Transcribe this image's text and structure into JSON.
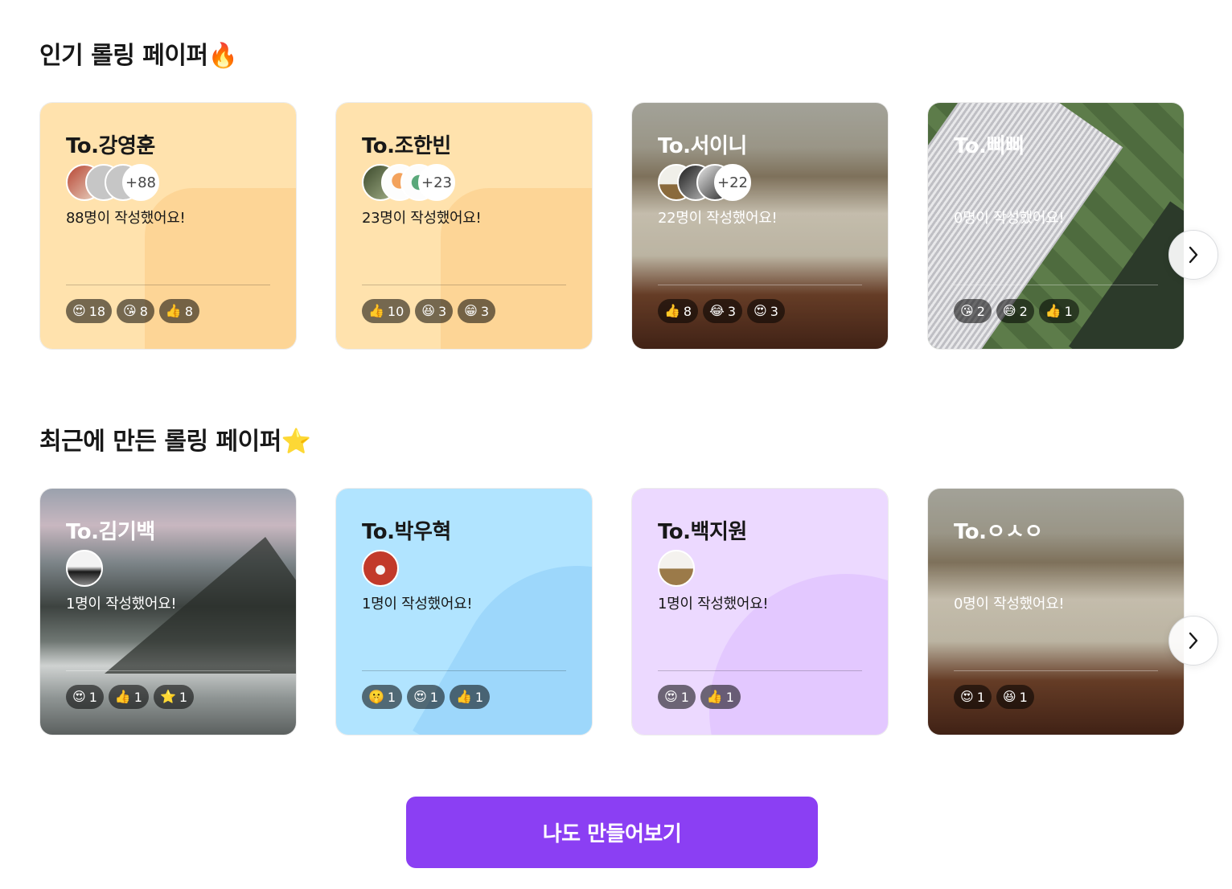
{
  "popular": {
    "title": "인기 롤링 페이퍼",
    "title_icon": "fire-icon",
    "cards": [
      {
        "to": "To.강영훈",
        "more": "+88",
        "count_text": "88명이 작성했어요!",
        "bg": "orange",
        "reactions": [
          {
            "emoji": "😍",
            "count": "18"
          },
          {
            "emoji": "😘",
            "count": "8"
          },
          {
            "emoji": "👍",
            "count": "8"
          }
        ]
      },
      {
        "to": "To.조한빈",
        "more": "+23",
        "count_text": "23명이 작성했어요!",
        "bg": "orange",
        "reactions": [
          {
            "emoji": "👍",
            "count": "10"
          },
          {
            "emoji": "😆",
            "count": "3"
          },
          {
            "emoji": "😁",
            "count": "3"
          }
        ]
      },
      {
        "to": "To.서이니",
        "more": "+22",
        "count_text": "22명이 작성했어요!",
        "bg": "book-image",
        "reactions": [
          {
            "emoji": "👍",
            "count": "8"
          },
          {
            "emoji": "😂",
            "count": "3"
          },
          {
            "emoji": "😍",
            "count": "3"
          }
        ]
      },
      {
        "to": "To.삐삐",
        "count_text": "0명이 작성했어요!",
        "bg": "stadium-image",
        "reactions": [
          {
            "emoji": "😘",
            "count": "2"
          },
          {
            "emoji": "😅",
            "count": "2"
          },
          {
            "emoji": "👍",
            "count": "1"
          }
        ]
      }
    ]
  },
  "recent": {
    "title": "최근에 만든 롤링 페이퍼",
    "title_icon": "star-icon",
    "cards": [
      {
        "to": "To.김기백",
        "count_text": "1명이 작성했어요!",
        "bg": "mountain-image",
        "reactions": [
          {
            "emoji": "😍",
            "count": "1"
          },
          {
            "emoji": "👍",
            "count": "1"
          },
          {
            "emoji": "⭐",
            "count": "1"
          }
        ]
      },
      {
        "to": "To.박우혁",
        "count_text": "1명이 작성했어요!",
        "bg": "blue",
        "reactions": [
          {
            "emoji": "🤫",
            "count": "1"
          },
          {
            "emoji": "😍",
            "count": "1"
          },
          {
            "emoji": "👍",
            "count": "1"
          }
        ]
      },
      {
        "to": "To.백지원",
        "count_text": "1명이 작성했어요!",
        "bg": "purple",
        "reactions": [
          {
            "emoji": "😍",
            "count": "1"
          },
          {
            "emoji": "👍",
            "count": "1"
          }
        ]
      },
      {
        "to": "To.ㅇㅅㅇ",
        "count_text": "0명이 작성했어요!",
        "bg": "book-image",
        "reactions": [
          {
            "emoji": "😍",
            "count": "1"
          },
          {
            "emoji": "😆",
            "count": "1"
          }
        ]
      }
    ]
  },
  "cta_label": "나도 만들어보기",
  "colors": {
    "accent": "#8b3ff3",
    "orange": "#ffe2ad",
    "blue": "#b1e4ff",
    "purple": "#ecd9ff"
  }
}
